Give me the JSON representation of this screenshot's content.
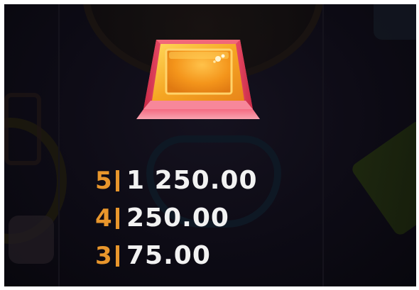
{
  "symbol": {
    "name": "gold-gem-block",
    "colors": {
      "base": "#ee4f66",
      "top": "#f6b021",
      "highlight": "#ffe07a"
    }
  },
  "colors": {
    "background": "#0d0b15",
    "count": "#e8962c",
    "amount": "#f2f2f2"
  },
  "paytable": [
    {
      "count": "5",
      "amount": "1 250.00"
    },
    {
      "count": "4",
      "amount": "250.00"
    },
    {
      "count": "3",
      "amount": "75.00"
    }
  ]
}
